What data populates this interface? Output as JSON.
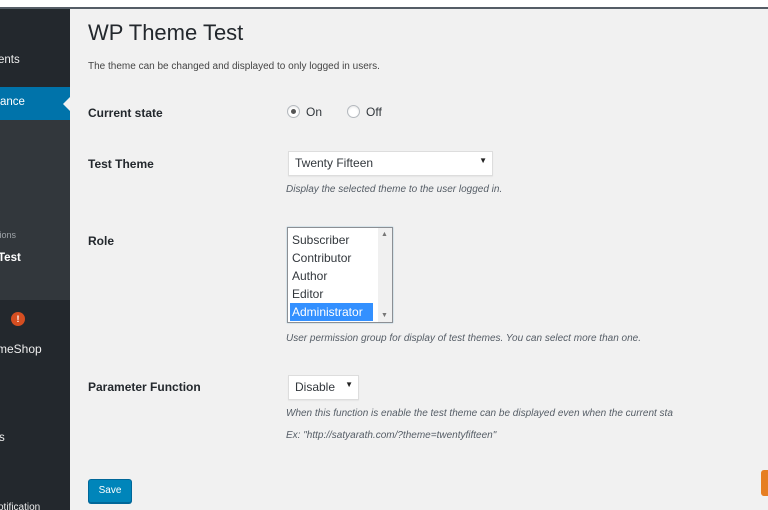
{
  "sidebar": {
    "comments": "ents",
    "appearance": "ance",
    "options": "tions",
    "test": "Test",
    "badge": "!",
    "themeshop": "meShop",
    "s": "s",
    "notification": "otification"
  },
  "page": {
    "title": "WP Theme Test",
    "description": "The theme can be changed and displayed to only logged in users."
  },
  "current_state": {
    "label": "Current state",
    "options": [
      "On",
      "Off"
    ],
    "selected": "On"
  },
  "test_theme": {
    "label": "Test Theme",
    "selected": "Twenty Fifteen",
    "help": "Display the selected theme to the user logged in."
  },
  "role": {
    "label": "Role",
    "options": [
      "Subscriber",
      "Contributor",
      "Author",
      "Editor",
      "Administrator"
    ],
    "selected": "Administrator",
    "help": "User permission group for display of test themes. You can select more than one."
  },
  "parameter_function": {
    "label": "Parameter Function",
    "selected": "Disable",
    "help": "When this function is enable the test theme can be displayed even when the current sta",
    "example": "Ex: \"http://satyarath.com/?theme=twentyfifteen\""
  },
  "actions": {
    "save_label": "Save"
  },
  "colors": {
    "sidebar_bg": "#23282d",
    "active_menu": "#0073aa",
    "primary_button": "#0085ba",
    "badge": "#d54e21",
    "selection": "#3390ff"
  },
  "icons": {
    "radio": "radio-icon",
    "caret": "caret-down-icon",
    "scroll_up": "scroll-up-icon",
    "scroll_down": "scroll-down-icon"
  }
}
